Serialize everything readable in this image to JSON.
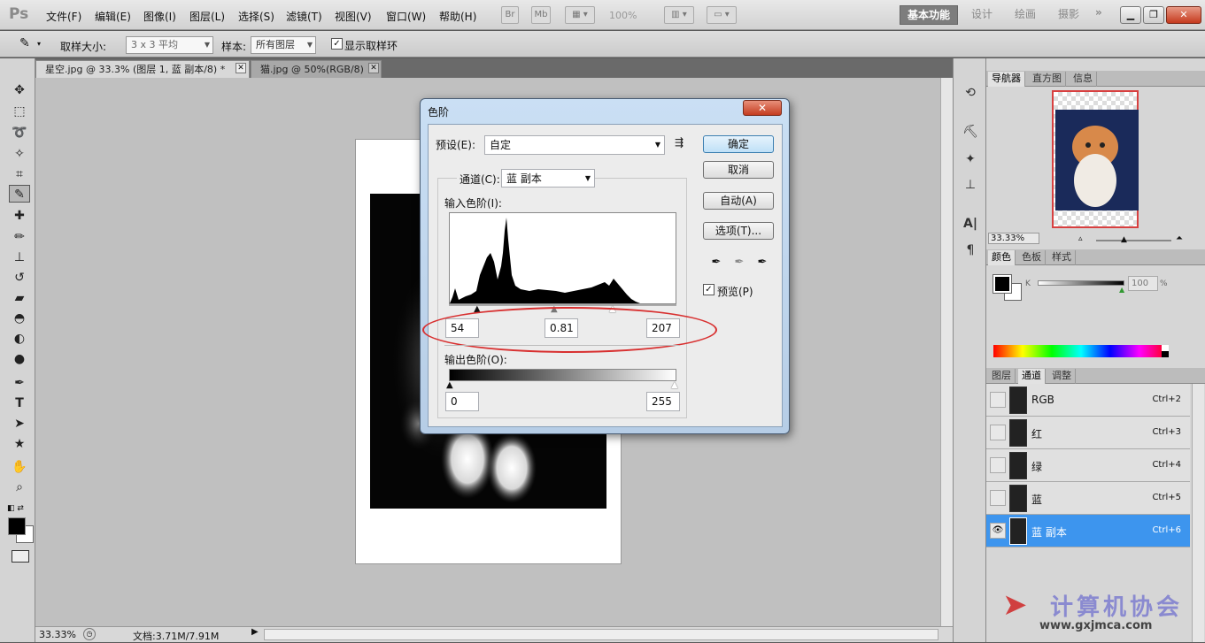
{
  "app": {
    "logo": "Ps",
    "menus": [
      "文件(F)",
      "编辑(E)",
      "图像(I)",
      "图层(L)",
      "选择(S)",
      "滤镜(T)",
      "视图(V)",
      "窗口(W)",
      "帮助(H)"
    ],
    "br": "Br",
    "mb": "Mb",
    "zoom": "100%",
    "workspaces": {
      "active": "基本功能",
      "others": [
        "设计",
        "绘画",
        "摄影"
      ],
      "more": "»"
    }
  },
  "options": {
    "sample_size_label": "取样大小:",
    "sample_size_value": "3 x 3 平均",
    "sample_label": "样本:",
    "sample_value": "所有图层",
    "ring_label": "显示取样环"
  },
  "tabs": [
    {
      "label": "星空.jpg @ 33.3% (图层 1, 蓝 副本/8) *"
    },
    {
      "label": "猫.jpg @ 50%(RGB/8)"
    }
  ],
  "status": {
    "zoom": "33.33%",
    "doc": "文档:3.71M/7.91M"
  },
  "dialog": {
    "title": "色阶",
    "preset_label": "预设(E):",
    "preset_value": "自定",
    "channel_label": "通道(C):",
    "channel_value": "蓝 副本",
    "input_label": "输入色阶(I):",
    "input_black": "54",
    "input_gamma": "0.81",
    "input_white": "207",
    "output_label": "输出色阶(O):",
    "output_black": "0",
    "output_white": "255",
    "ok": "确定",
    "cancel": "取消",
    "auto": "自动(A)",
    "options": "选项(T)...",
    "preview": "预览(P)"
  },
  "panels": {
    "nav_tabs": [
      "导航器",
      "直方图",
      "信息"
    ],
    "nav_zoom": "33.33%",
    "color_tabs": [
      "颜色",
      "色板",
      "样式"
    ],
    "k_label": "K",
    "k_value": "100",
    "k_unit": "%",
    "layer_tabs": [
      "图层",
      "通道",
      "调整"
    ],
    "channels": [
      {
        "name": "RGB",
        "shortcut": "Ctrl+2"
      },
      {
        "name": "红",
        "shortcut": "Ctrl+3"
      },
      {
        "name": "绿",
        "shortcut": "Ctrl+4"
      },
      {
        "name": "蓝",
        "shortcut": "Ctrl+5"
      },
      {
        "name": "蓝 副本",
        "shortcut": "Ctrl+6"
      }
    ]
  },
  "watermark": {
    "text": "计算机协会",
    "url": "www.gxjmca.com"
  }
}
